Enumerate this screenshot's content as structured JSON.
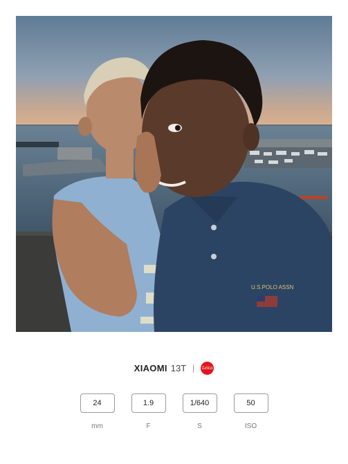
{
  "photo": {
    "subject": "photo-of-two-boys-whispering-at-sunset-harbor"
  },
  "brand": {
    "name": "XIAOMI",
    "model": "13T",
    "separator": "|",
    "logo_text": "Leica",
    "logo_color": "#e1171f"
  },
  "specs": [
    {
      "value": "24",
      "unit": "mm"
    },
    {
      "value": "1.9",
      "unit": "F"
    },
    {
      "value": "1/640",
      "unit": "S"
    },
    {
      "value": "50",
      "unit": "ISO"
    }
  ]
}
